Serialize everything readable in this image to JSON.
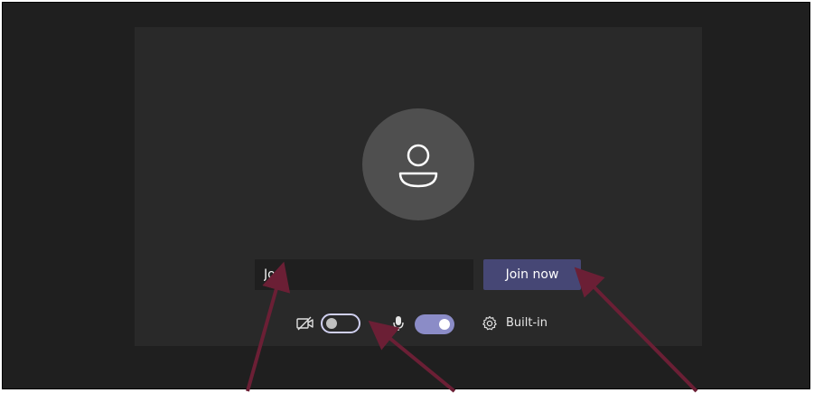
{
  "prejoin": {
    "name_value": "Joe",
    "join_label": "Join now",
    "audio_device_label": "Built-in",
    "camera_enabled": false,
    "mic_enabled": true
  },
  "icons": {
    "avatar": "user-avatar-icon",
    "camera": "camera-off-icon",
    "mic": "microphone-icon",
    "settings": "gear-icon"
  },
  "colors": {
    "background": "#1f1f1f",
    "panel": "#292929",
    "avatar_circle": "#4f4f4f",
    "join_button": "#464775",
    "toggle_on": "#8b8cc7",
    "annotation_arrow": "#6b1f35"
  }
}
